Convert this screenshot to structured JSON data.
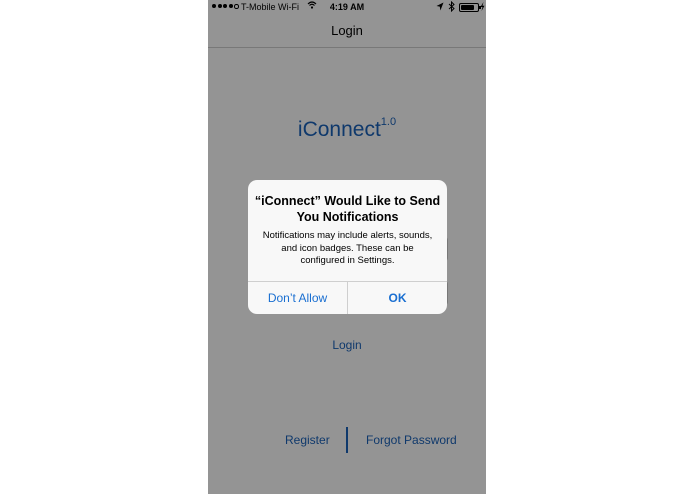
{
  "status_bar": {
    "carrier": "T-Mobile Wi-Fi",
    "time": "4:19 AM",
    "icons": [
      "signal-dots",
      "wifi-icon",
      "location-icon",
      "bluetooth-icon",
      "battery-icon",
      "charging-icon"
    ]
  },
  "nav": {
    "title": "Login"
  },
  "app": {
    "name": "iConnect",
    "version": "1.0"
  },
  "links": {
    "login": "Login",
    "register": "Register",
    "forgot_password": "Forgot Password"
  },
  "alert": {
    "title": "“iConnect” Would Like to Send You Notifications",
    "message": "Notifications may include alerts, sounds, and icon badges. These can be configured in Settings.",
    "dont_allow": "Don’t Allow",
    "ok": "OK"
  },
  "colors": {
    "link_blue": "#1a5fb4",
    "alert_button_blue": "#1a6fd1",
    "dim_overlay": "rgba(0,0,0,0.40)"
  }
}
